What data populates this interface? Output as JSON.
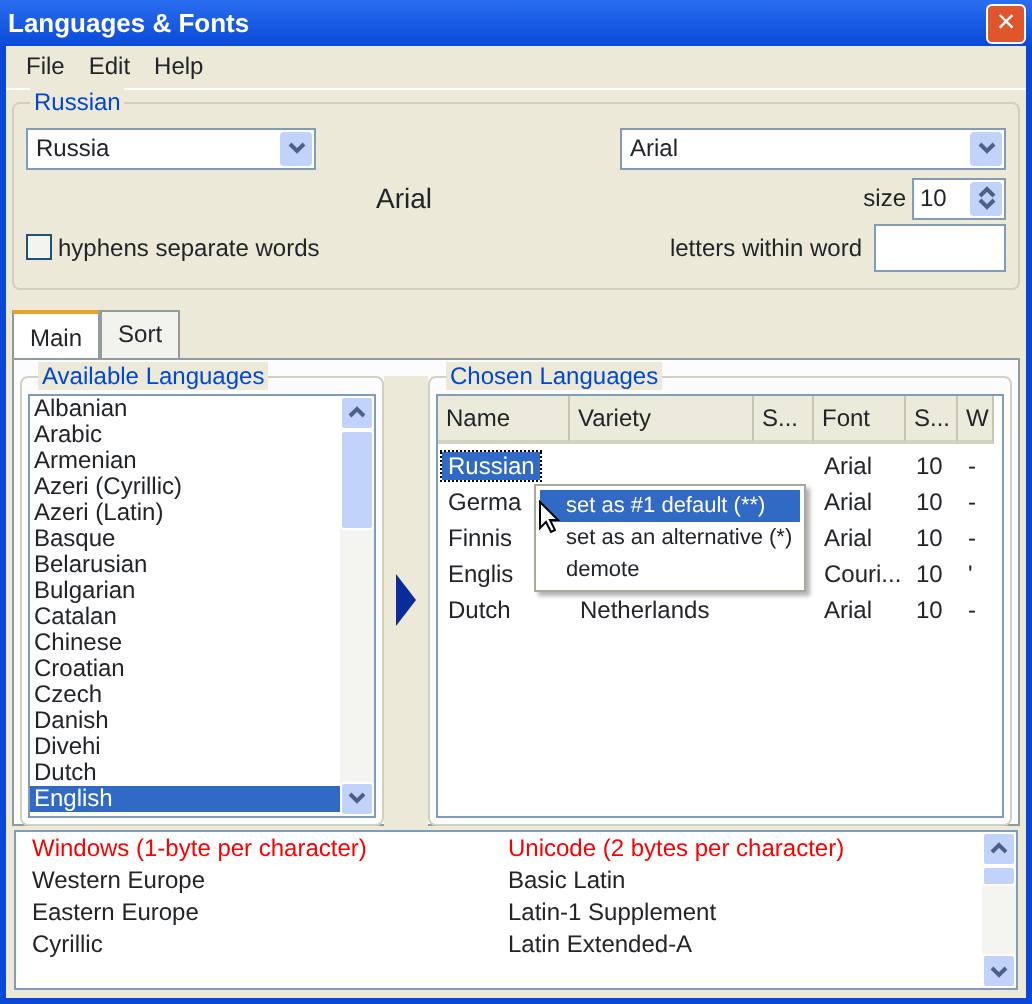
{
  "window": {
    "title": "Languages & Fonts",
    "close": "×"
  },
  "menu": [
    "File",
    "Edit",
    "Help"
  ],
  "language_group": {
    "legend": "Russian",
    "variety_select": "Russia",
    "font_select": "Arial",
    "font_preview": "Arial",
    "size_label": "size",
    "size_value": "10",
    "hyphens": {
      "label": "hyphens separate words",
      "checked": false
    },
    "letters_label": "letters within word"
  },
  "tabs": [
    {
      "label": "Main",
      "selected": true
    },
    {
      "label": "Sort",
      "selected": false
    }
  ],
  "available": {
    "legend": "Available Languages",
    "items": [
      {
        "label": "Albanian",
        "selected": false
      },
      {
        "label": "Arabic",
        "selected": false
      },
      {
        "label": "Armenian",
        "selected": false
      },
      {
        "label": "Azeri (Cyrillic)",
        "selected": false
      },
      {
        "label": "Azeri (Latin)",
        "selected": false
      },
      {
        "label": "Basque",
        "selected": false
      },
      {
        "label": "Belarusian",
        "selected": false
      },
      {
        "label": "Bulgarian",
        "selected": false
      },
      {
        "label": "Catalan",
        "selected": false
      },
      {
        "label": "Chinese",
        "selected": false
      },
      {
        "label": "Croatian",
        "selected": false
      },
      {
        "label": "Czech",
        "selected": false
      },
      {
        "label": "Danish",
        "selected": false
      },
      {
        "label": "Divehi",
        "selected": false
      },
      {
        "label": "Dutch",
        "selected": false
      },
      {
        "label": "English",
        "selected": true
      }
    ]
  },
  "chosen": {
    "legend": "Chosen Languages",
    "columns": [
      "Name",
      "Variety",
      "S...",
      "Font",
      "S...",
      "W"
    ],
    "rows": [
      {
        "cells": [
          "Russian",
          "",
          "",
          "Arial",
          "10",
          "-"
        ],
        "selected": true
      },
      {
        "cells": [
          "Germa",
          "",
          "",
          "Arial",
          "10",
          "-"
        ],
        "selected": false
      },
      {
        "cells": [
          "Finnis",
          "",
          "",
          "Arial",
          "10",
          "-"
        ],
        "selected": false
      },
      {
        "cells": [
          "Englis",
          "",
          "",
          "Couri...",
          "10",
          "'"
        ],
        "selected": false
      },
      {
        "cells": [
          "Dutch",
          "Netherlands",
          "",
          "Arial",
          "10",
          "-"
        ],
        "selected": false
      }
    ],
    "context_menu": [
      {
        "label": "set as #1 default (**)",
        "selected": true
      },
      {
        "label": "set as an alternative (*)",
        "selected": false
      },
      {
        "label": "demote",
        "selected": false
      }
    ]
  },
  "charsets": {
    "columns": [
      {
        "heading": "Windows (1-byte per character)",
        "items": [
          "Western Europe",
          "Eastern Europe",
          "Cyrillic"
        ]
      },
      {
        "heading": "Unicode (2 bytes per character)",
        "items": [
          "Basic Latin",
          "Latin-1 Supplement",
          "Latin Extended-A"
        ]
      }
    ]
  }
}
